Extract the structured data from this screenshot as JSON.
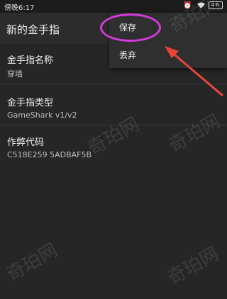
{
  "status_bar": {
    "time": "傍晚6:17",
    "battery": "46"
  },
  "toolbar": {
    "title": "新的金手指"
  },
  "fields": [
    {
      "label": "金手指名称",
      "value": "穿墙"
    },
    {
      "label": "金手指类型",
      "value": "GameShark v1/v2"
    },
    {
      "label": "作弊代码",
      "value": "C518E259 5ADBAF5B"
    }
  ],
  "menu": {
    "items": [
      "保存",
      "丢弃"
    ]
  },
  "watermark": "奇珀网",
  "colors": {
    "highlight": "#d23bdc",
    "arrow": "#e8453c"
  }
}
